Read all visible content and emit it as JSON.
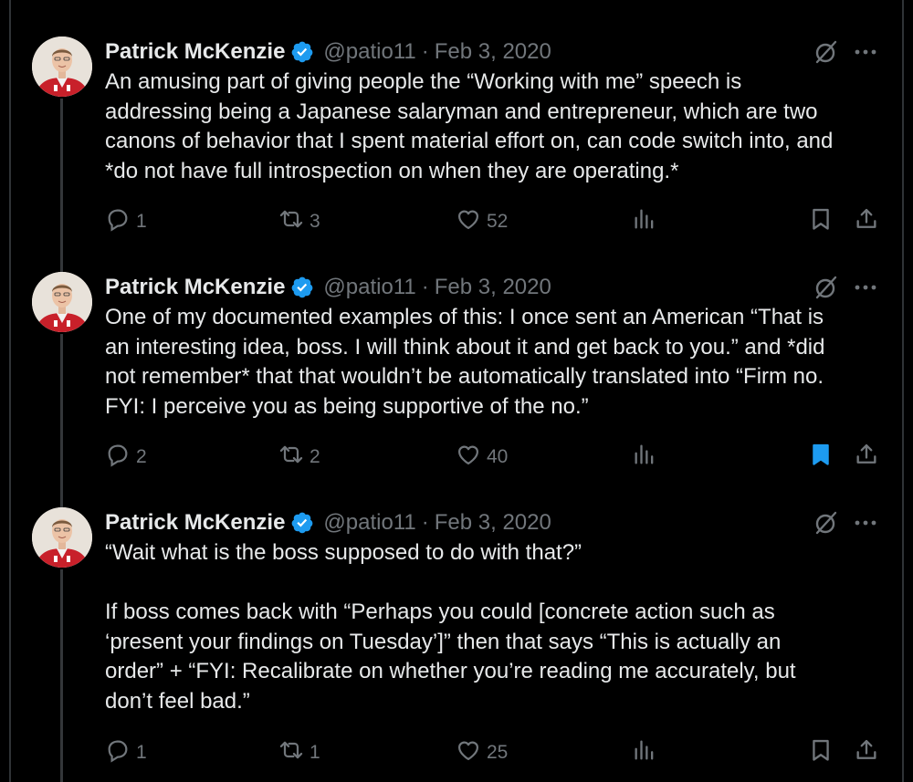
{
  "tweets": [
    {
      "name": "Patrick McKenzie",
      "handle": "@patio11",
      "separator": "·",
      "date": "Feb 3, 2020",
      "lines": [
        "An amusing part of giving people the “Working with me” speech is",
        "addressing being a Japanese salaryman and entrepreneur, which are two",
        "canons of behavior that I spent material effort on, can code switch into, and",
        "*do not have full introspection on when they are operating.*"
      ],
      "replies": "1",
      "retweets": "3",
      "likes": "52",
      "bookmarked": false
    },
    {
      "name": "Patrick McKenzie",
      "handle": "@patio11",
      "separator": "·",
      "date": "Feb 3, 2020",
      "lines": [
        "One of my documented examples of this: I once sent an American “That is",
        "an interesting idea, boss. I will think about it and get back to you.” and *did",
        "not remember* that that wouldn’t be automatically translated into “Firm no.",
        "FYI: I perceive you as being supportive of the no.”"
      ],
      "replies": "2",
      "retweets": "2",
      "likes": "40",
      "bookmarked": true
    },
    {
      "name": "Patrick McKenzie",
      "handle": "@patio11",
      "separator": "·",
      "date": "Feb 3, 2020",
      "lines": [
        "“Wait what is the boss supposed to do with that?”",
        "",
        "If boss comes back with “Perhaps you could [concrete action such as",
        "‘present your findings on Tuesday’]” then that says “This is actually an",
        "order” + “FYI: Recalibrate on whether you’re reading me accurately, but",
        "don’t feel bad.”"
      ],
      "replies": "1",
      "retweets": "1",
      "likes": "25",
      "bookmarked": false
    }
  ],
  "colors": {
    "background": "#000000",
    "text": "#e7e9ea",
    "muted": "#71767b",
    "verified": "#1d9bf0",
    "bookmark_active": "#1d9bf0",
    "thread_line": "#333639"
  },
  "icons": {
    "verified": "verified-badge-icon",
    "grok": "grok-icon",
    "more": "more-icon",
    "reply": "reply-icon",
    "retweet": "retweet-icon",
    "like": "heart-icon",
    "views": "views-icon",
    "bookmark": "bookmark-icon",
    "share": "share-icon"
  }
}
